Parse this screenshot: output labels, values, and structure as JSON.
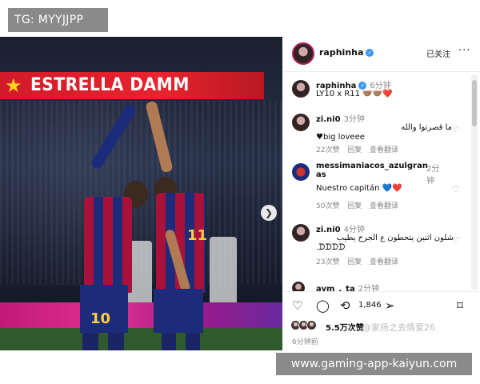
{
  "overlay": {
    "top_left_tag": "TG: MYYJJPP",
    "bottom_right_tag": "www.gaming-app-kaiyun.com"
  },
  "photo": {
    "banner_text": "ESTRELLA DAMM",
    "jersey_numbers": [
      "10",
      "11"
    ],
    "next_icon": "chevron-right-icon"
  },
  "post": {
    "username": "raphinha",
    "verified_icon": "verified-badge-icon",
    "follow_status": "已关注",
    "more_icon": "more-dots-icon",
    "caption": {
      "username": "raphinha",
      "time": "6分钟",
      "text": "LY10 x R11 🤝🏽🤝🏽❤️"
    },
    "comments": [
      {
        "username": "zi.ni0",
        "time": "3分钟",
        "text_line1": "ما قصرتوا والله",
        "text_line2": "♥big loveee",
        "likes": "22次赞",
        "reply": "回复",
        "translate": "查看翻译"
      },
      {
        "username": "messimaniacos_azulgranas",
        "time": "2分钟",
        "text_line1": "Nuestro capitán 💙❤️",
        "text_line2": "",
        "likes": "50次赞",
        "reply": "回复",
        "translate": "查看翻译"
      },
      {
        "username": "zi.ni0",
        "time": "4分钟",
        "text_line1": "شلون اثنين يتحطون ع الجرح يطيب",
        "text_line2": ".ᗪᗪᗪᗪ",
        "likes": "23次赞",
        "reply": "回复",
        "translate": "查看翻译"
      },
      {
        "username": "aym_._ta",
        "time": "2分钟",
        "text_line1": "",
        "text_line2": "",
        "likes": "",
        "reply": "",
        "translate": ""
      }
    ],
    "share_count": "1,846",
    "likes_summary": "5.5万次赞",
    "watermark": "@家扬之去情爱26",
    "posted_time": "6分钟前"
  },
  "colors": {
    "verified": "#3897f0",
    "banner_red": "#e8242e",
    "tag_gray": "#8a8a8a"
  }
}
